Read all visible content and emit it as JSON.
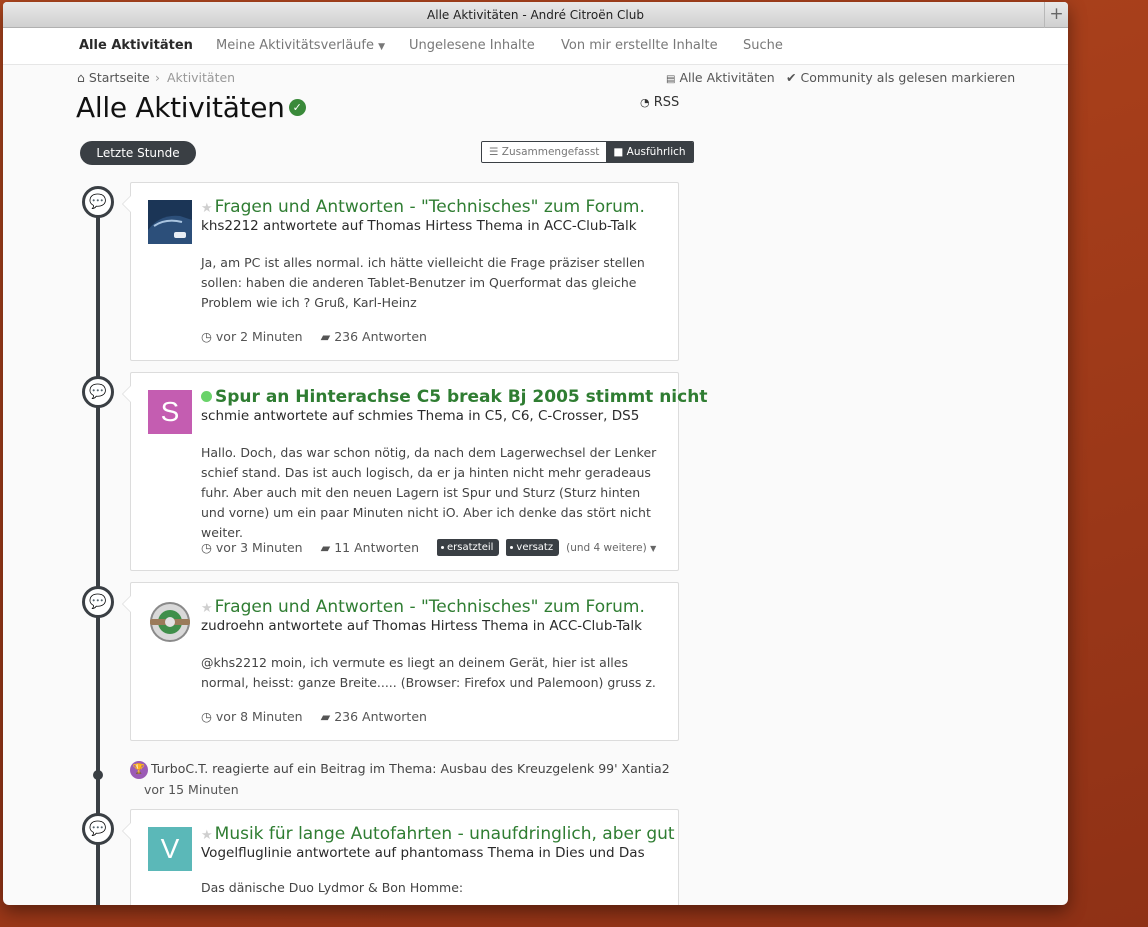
{
  "window": {
    "title": "Alle Aktivitäten - André Citroën Club",
    "newtab_icon": "plus-icon"
  },
  "nav": {
    "items": [
      {
        "label": "Alle Aktivitäten",
        "active": true
      },
      {
        "label": "Meine Aktivitätsverläufe",
        "dropdown": true
      },
      {
        "label": "Ungelesene Inhalte"
      },
      {
        "label": "Von mir erstellte Inhalte"
      },
      {
        "label": "Suche"
      }
    ]
  },
  "breadcrumb": {
    "home": "Startseite",
    "current": "Aktivitäten"
  },
  "actions": {
    "all_activity": "Alle Aktivitäten",
    "mark_read": "Community als gelesen markieren"
  },
  "page": {
    "title": "Alle Aktivitäten",
    "rss": "RSS"
  },
  "filter": {
    "time_label": "Letzte Stunde",
    "view_condensed": "Zusammengefasst",
    "view_expanded": "Ausführlich"
  },
  "stream": [
    {
      "title": "Fragen und Antworten - \"Technisches\" zum Forum.",
      "meta": "khs2212 antwortete auf Thomas Hirtess Thema in ACC-Club-Talk",
      "body": "Ja, am PC ist alles normal. ich hätte vielleicht die Frage präziser stellen sollen: haben die anderen Tablet-Benutzer im Querformat das gleiche Problem wie ich ? Gruß, Karl-Heinz",
      "time": "vor 2 Minuten",
      "replies": "236 Antworten"
    },
    {
      "avatar_letter": "S",
      "title": "Spur an Hinterachse C5 break Bj 2005 stimmt nicht",
      "meta": "schmie antwortete auf schmies Thema in C5, C6, C-Crosser, DS5",
      "body": "Hallo. Doch, das war schon nötig, da nach dem Lagerwechsel der Lenker schief stand. Das ist auch logisch, da er ja hinten nicht mehr geradeaus fuhr. Aber auch mit den neuen Lagern ist Spur und Sturz (Sturz hinten und vorne) um ein paar Minuten nicht iO. Aber ich denke das stört nicht weiter.",
      "time": "vor 3 Minuten",
      "replies": "11 Antworten",
      "tags": [
        "ersatzteil",
        "versatz"
      ],
      "more_tags": "(und 4 weitere)"
    },
    {
      "title": "Fragen und Antworten - \"Technisches\" zum Forum.",
      "meta": "zudroehn antwortete auf Thomas Hirtess Thema in ACC-Club-Talk",
      "body": "@khs2212 moin, ich vermute es liegt an deinem Gerät, hier ist alles normal, heisst: ganze Breite..... (Browser: Firefox und Palemoon) gruss z.",
      "time": "vor 8 Minuten",
      "replies": "236 Antworten"
    },
    {
      "avatar_letter": "V",
      "title": "Musik für lange Autofahrten - unaufdringlich, aber gut",
      "meta": "Vogelfluglinie antwortete auf phantomass Thema in Dies und Das",
      "body": "Das dänische Duo Lydmor & Bon Homme:"
    }
  ],
  "reaction": {
    "text": "TurboC.T. reagierte auf ein Beitrag im Thema: Ausbau des Kreuzgelenk 99' Xantia2",
    "time": "vor 15 Minuten"
  },
  "colors": {
    "accent_green": "#2f7d32",
    "timeline_dark": "#3a3f44",
    "avatar_s": "#c45db1",
    "avatar_v": "#5bb8b8",
    "trophy_purple": "#9b5ab5"
  }
}
